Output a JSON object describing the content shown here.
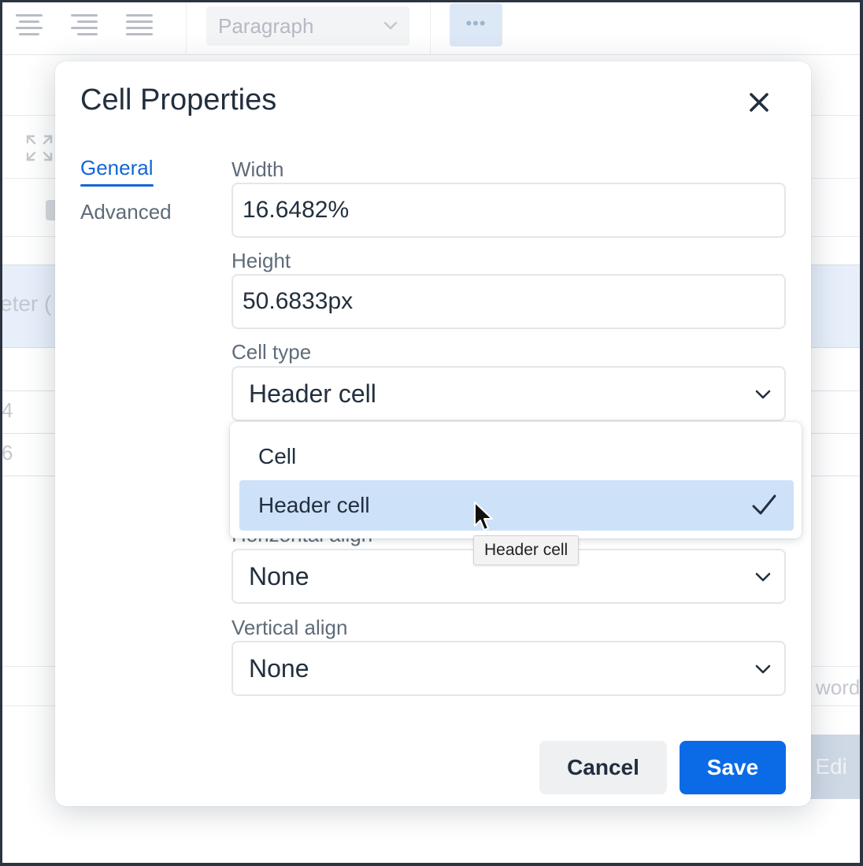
{
  "background": {
    "toolbar": {
      "paragraph_select": "Paragraph",
      "more_label": "•••"
    },
    "fragments": {
      "header_cell_text": "eter (",
      "row1_text": "4",
      "row2_text": "6",
      "word_count_text": "word",
      "button_text": "e Edi"
    }
  },
  "modal": {
    "title": "Cell Properties",
    "nav": {
      "general": "General",
      "advanced": "Advanced"
    },
    "fields": {
      "width": {
        "label": "Width",
        "value": "16.6482%"
      },
      "height": {
        "label": "Height",
        "value": "50.6833px"
      },
      "cell_type": {
        "label": "Cell type",
        "value": "Header cell"
      },
      "horizontal_align": {
        "label": "Horizontal align",
        "value": "None"
      },
      "vertical_align": {
        "label": "Vertical align",
        "value": "None"
      }
    },
    "buttons": {
      "cancel": "Cancel",
      "save": "Save"
    }
  },
  "dropdown": {
    "options": [
      "Cell",
      "Header cell"
    ],
    "selected": "Header cell"
  },
  "tooltip": "Header cell",
  "colors": {
    "accent": "#0b6be6",
    "link": "#1266d6",
    "selected_option": "#cde1f9",
    "text": "#222f3e"
  }
}
